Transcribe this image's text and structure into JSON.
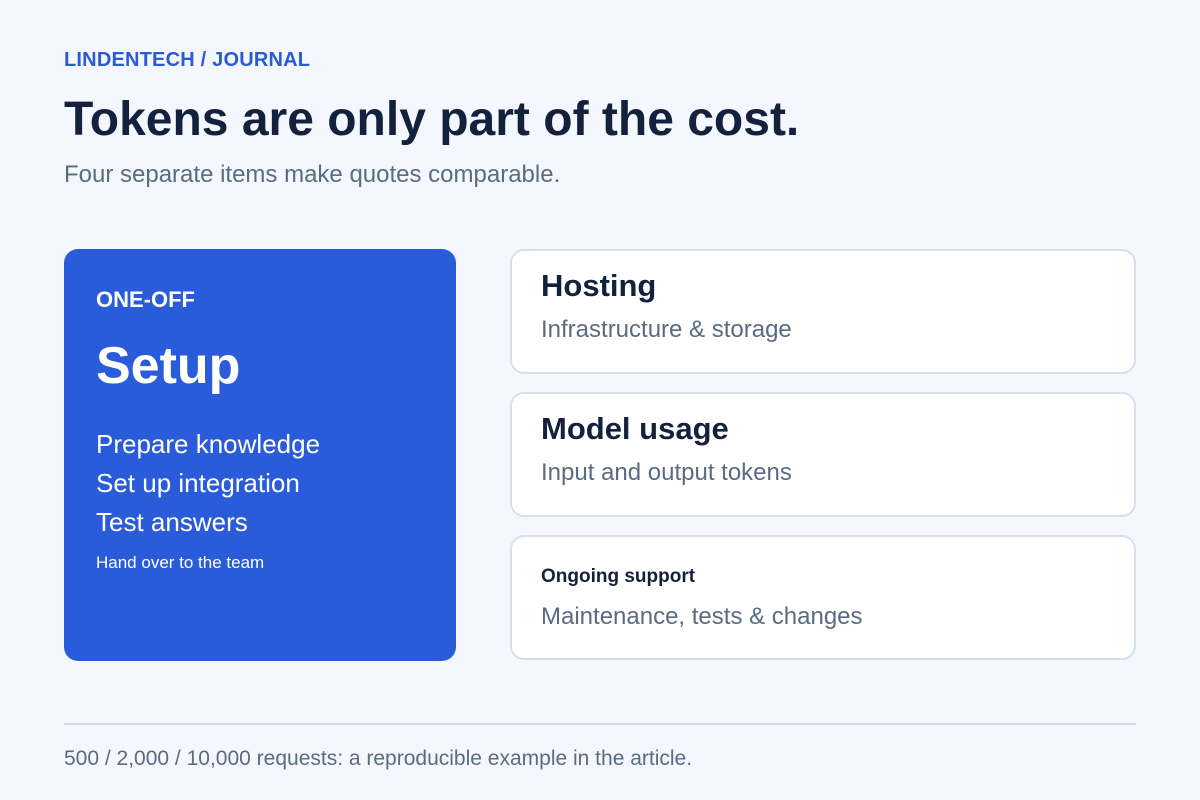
{
  "header": {
    "eyebrow": "LINDENTECH / JOURNAL",
    "title": "Tokens are only part of the cost.",
    "subtitle": "Four separate items make quotes comparable."
  },
  "setup": {
    "kicker": "ONE-OFF",
    "title": "Setup",
    "steps": [
      "Prepare knowledge",
      "Set up integration",
      "Test answers"
    ],
    "note": "Hand over to the team"
  },
  "costs": [
    {
      "title": "Hosting",
      "description": "Infrastructure & storage"
    },
    {
      "title": "Model usage",
      "description": "Input and output tokens"
    },
    {
      "title": "Ongoing support",
      "description": "Maintenance, tests & changes"
    }
  ],
  "footer": {
    "note": "500 / 2,000 / 10,000 requests: a reproducible example in the article."
  },
  "colors": {
    "accent": "#2a5bd9",
    "background": "#f4f7fd",
    "heading": "#14213d",
    "muted": "#5b6b82"
  }
}
